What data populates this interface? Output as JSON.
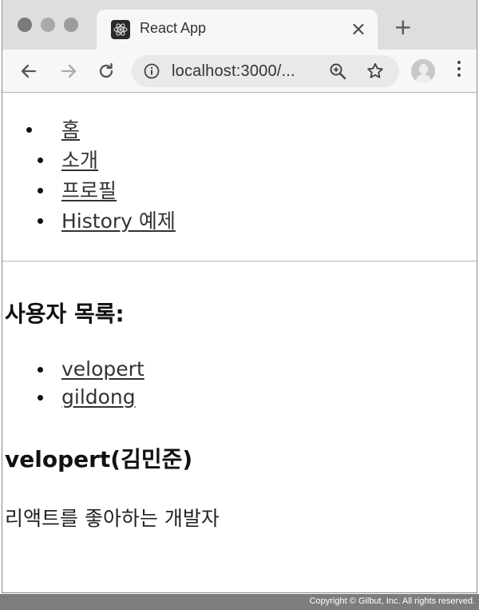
{
  "browser": {
    "tab_title": "React App",
    "tab_close_glyph": "×",
    "new_tab_glyph": "+",
    "url": "localhost:3000/...",
    "icons": {
      "back": "arrow-left-icon",
      "forward": "arrow-right-icon",
      "reload": "reload-icon",
      "info": "info-icon",
      "zoom": "zoom-icon",
      "bookmark": "star-icon",
      "profile": "avatar-icon",
      "menu": "kebab-menu-icon"
    }
  },
  "page": {
    "nav": [
      {
        "label": "홈"
      },
      {
        "label": "소개"
      },
      {
        "label": "프로필"
      },
      {
        "label": "History 예제"
      }
    ],
    "section_title": "사용자 목록:",
    "users": [
      {
        "label": "velopert"
      },
      {
        "label": "gildong"
      }
    ],
    "profile": {
      "name": "velopert(김민준)",
      "description": "리액트를 좋아하는 개발자"
    }
  },
  "footer": {
    "copyright": "Copyright © Gilbut, Inc. All rights reserved."
  }
}
